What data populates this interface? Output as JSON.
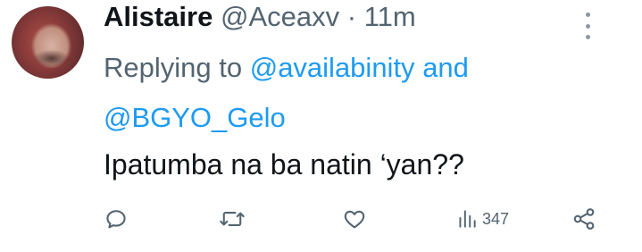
{
  "tweet": {
    "author_name": "Alistaire",
    "author_handle": "@Aceaxv",
    "separator": "·",
    "time": "11m",
    "replying_prefix": "Replying to",
    "mentions": [
      "@availabinity",
      "@BGYO_Gelo"
    ],
    "mention_joiner": "and",
    "body": "Ipatumba na ba natin ‘yan??",
    "views_count": "347"
  },
  "icons": {
    "more": "more-dots-icon",
    "reply": "reply-icon",
    "retweet": "retweet-icon",
    "like": "heart-icon",
    "views": "views-bar-chart-icon",
    "share": "share-icon"
  },
  "colors": {
    "text": "#0f1419",
    "secondary": "#536471",
    "link": "#1d9bf0"
  }
}
